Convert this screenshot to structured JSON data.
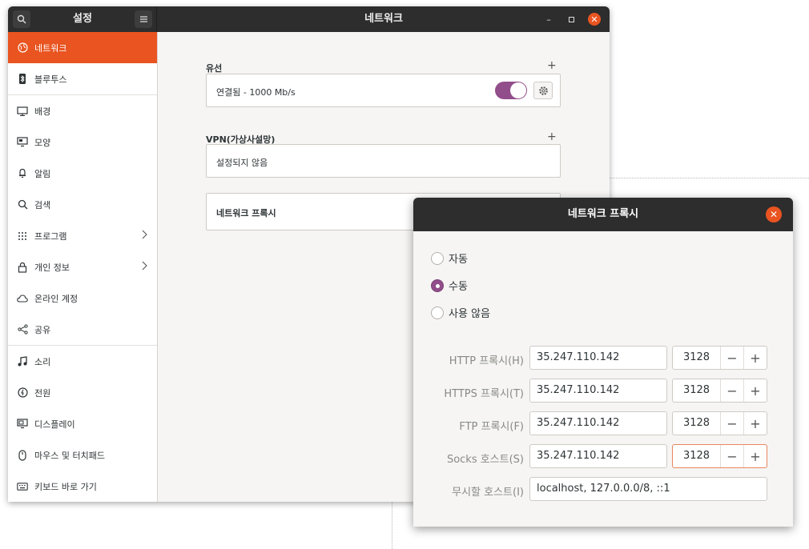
{
  "main_window": {
    "sidebar_title": "설정",
    "page_title": "네트워크",
    "colors": {
      "accent": "#e95420",
      "toggle": "#924d8b",
      "titlebar": "#2d2d2d"
    }
  },
  "sidebar": {
    "items": [
      {
        "label": "네트워크",
        "icon": "network-icon",
        "active": true
      },
      {
        "label": "블루투스",
        "icon": "bluetooth-icon"
      },
      {
        "label": "배경",
        "icon": "background-icon"
      },
      {
        "label": "모양",
        "icon": "appearance-icon"
      },
      {
        "label": "알림",
        "icon": "bell-icon"
      },
      {
        "label": "검색",
        "icon": "search-icon"
      },
      {
        "label": "프로그램",
        "icon": "apps-grid-icon",
        "chevron": true
      },
      {
        "label": "개인 정보",
        "icon": "lock-icon",
        "chevron": true
      },
      {
        "label": "온라인 계정",
        "icon": "cloud-icon"
      },
      {
        "label": "공유",
        "icon": "share-icon"
      },
      {
        "label": "소리",
        "icon": "music-note-icon"
      },
      {
        "label": "전원",
        "icon": "power-icon"
      },
      {
        "label": "디스플레이",
        "icon": "display-icon"
      },
      {
        "label": "마우스 및 터치패드",
        "icon": "mouse-icon"
      },
      {
        "label": "키보드 바로 가기",
        "icon": "keyboard-icon"
      }
    ]
  },
  "network": {
    "wired_label": "유선",
    "wired_status": "연결됨 - 1000 Mb/s",
    "wired_enabled": true,
    "vpn_label": "VPN(가상사설망)",
    "vpn_status": "설정되지 않음",
    "proxy_label": "네트워크 프록시"
  },
  "proxy_dialog": {
    "title": "네트워크 프록시",
    "modes": [
      {
        "label": "자동",
        "selected": false
      },
      {
        "label": "수동",
        "selected": true
      },
      {
        "label": "사용 않음",
        "selected": false
      }
    ],
    "rows": [
      {
        "label": "HTTP 프록시(H)",
        "host": "35.247.110.142",
        "port": "3128"
      },
      {
        "label": "HTTPS 프록시(T)",
        "host": "35.247.110.142",
        "port": "3128"
      },
      {
        "label": "FTP 프록시(F)",
        "host": "35.247.110.142",
        "port": "3128"
      },
      {
        "label": "Socks 호스트(S)",
        "host": "35.247.110.142",
        "port": "3128"
      }
    ],
    "ignore_label": "무시할 호스트(I)",
    "ignore_value": "localhost, 127.0.0.0/8, ::1"
  }
}
